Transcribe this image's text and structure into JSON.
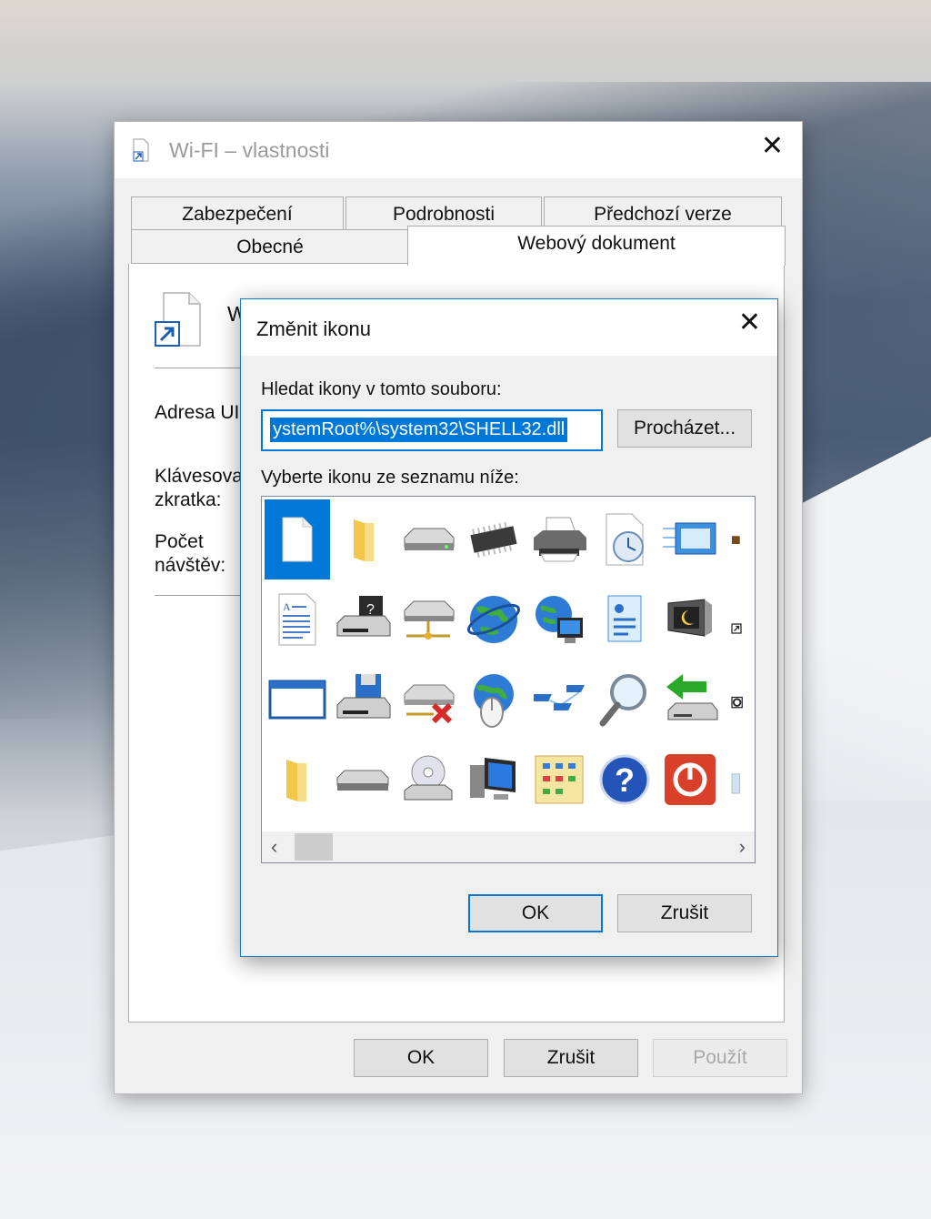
{
  "props_window": {
    "title": "Wi-FI – vlastnosti",
    "tabs_row1": [
      "Zabezpečení",
      "Podrobnosti",
      "Předchozí verze"
    ],
    "tabs_row2": [
      "Obecné",
      "Webový dokument"
    ],
    "name_partial": "W",
    "labels": {
      "url": "Adresa UI",
      "shortcut1": "Klávesova",
      "shortcut2": "zkratka:",
      "visits1": "Počet",
      "visits2": "návštěv:"
    },
    "buttons": {
      "ok": "OK",
      "cancel": "Zrušit",
      "apply": "Použít"
    }
  },
  "change_icon_dialog": {
    "title": "Změnit ikonu",
    "search_label": "Hledat ikony v tomto souboru:",
    "file_value": "ystemRoot%\\system32\\SHELL32.dll",
    "browse": "Procházet...",
    "list_label": "Vyberte ikonu ze seznamu níže:",
    "buttons": {
      "ok": "OK",
      "cancel": "Zrušit"
    },
    "icons": [
      [
        "blank-document",
        "folder",
        "hard-drive",
        "memory-chip",
        "printer",
        "document-clock",
        "display-settings",
        "partial-icon"
      ],
      [
        "text-document",
        "floppy-drive",
        "network-drive",
        "internet-globe",
        "network-globe",
        "contact-card",
        "monitor-moon",
        "shortcut-overlay"
      ],
      [
        "application-window",
        "floppy-save",
        "drive-disconnected",
        "globe-mouse",
        "network-connections",
        "magnifier",
        "green-arrow-drive",
        "partial-icon-2"
      ],
      [
        "folder-2",
        "removable-drive",
        "cd-drive",
        "computer-monitor",
        "control-panel",
        "help",
        "power",
        "recycle-bin-partial"
      ]
    ]
  }
}
